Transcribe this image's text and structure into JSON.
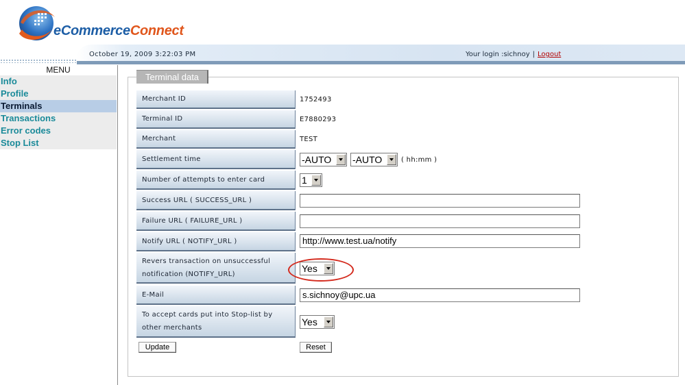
{
  "brand": {
    "part1": "eCommerce",
    "part2": "Connect"
  },
  "header": {
    "date": "October 19, 2009 3:22:03 PM",
    "login_prefix": "Your login :",
    "login_user": "sichnoy",
    "separator": "|",
    "logout": "Logout"
  },
  "menu": {
    "title": "MENU",
    "items": [
      "Info",
      "Profile",
      "Terminals",
      "Transactions",
      "Error codes",
      "Stop List"
    ],
    "active": "Terminals"
  },
  "tab": "Terminal data",
  "form": {
    "merchant_id": {
      "label": "Merchant ID",
      "value": "1752493"
    },
    "terminal_id": {
      "label": "Terminal ID",
      "value": "E7880293"
    },
    "merchant": {
      "label": "Merchant",
      "value": "TEST"
    },
    "settlement": {
      "label": "Settlement time",
      "hours": "-AUTO",
      "minutes": "-AUTO",
      "hint": "( hh:mm )"
    },
    "attempts": {
      "label": "Number of attempts to enter card",
      "value": "1"
    },
    "success_url": {
      "label": "Success URL ( SUCCESS_URL )",
      "value": ""
    },
    "failure_url": {
      "label": "Failure URL ( FAILURE_URL )",
      "value": ""
    },
    "notify_url": {
      "label": "Notify URL ( NOTIFY_URL )",
      "value": "http://www.test.ua/notify"
    },
    "revers": {
      "label_line1": "Revers transaction on unsuccessful",
      "label_line2": "notification (NOTIFY_URL)",
      "value": "Yes"
    },
    "email": {
      "label": "E-Mail",
      "value": "s.sichnoy@upc.ua"
    },
    "stoplist": {
      "label_line1": "To accept cards put into Stop-list by",
      "label_line2": "other merchants",
      "value": "Yes"
    }
  },
  "buttons": {
    "update": "Update",
    "reset": "Reset"
  },
  "colors": {
    "highlight_circle": "#d42b1e",
    "menu_link": "#1a8a99",
    "logout": "#b20000"
  }
}
